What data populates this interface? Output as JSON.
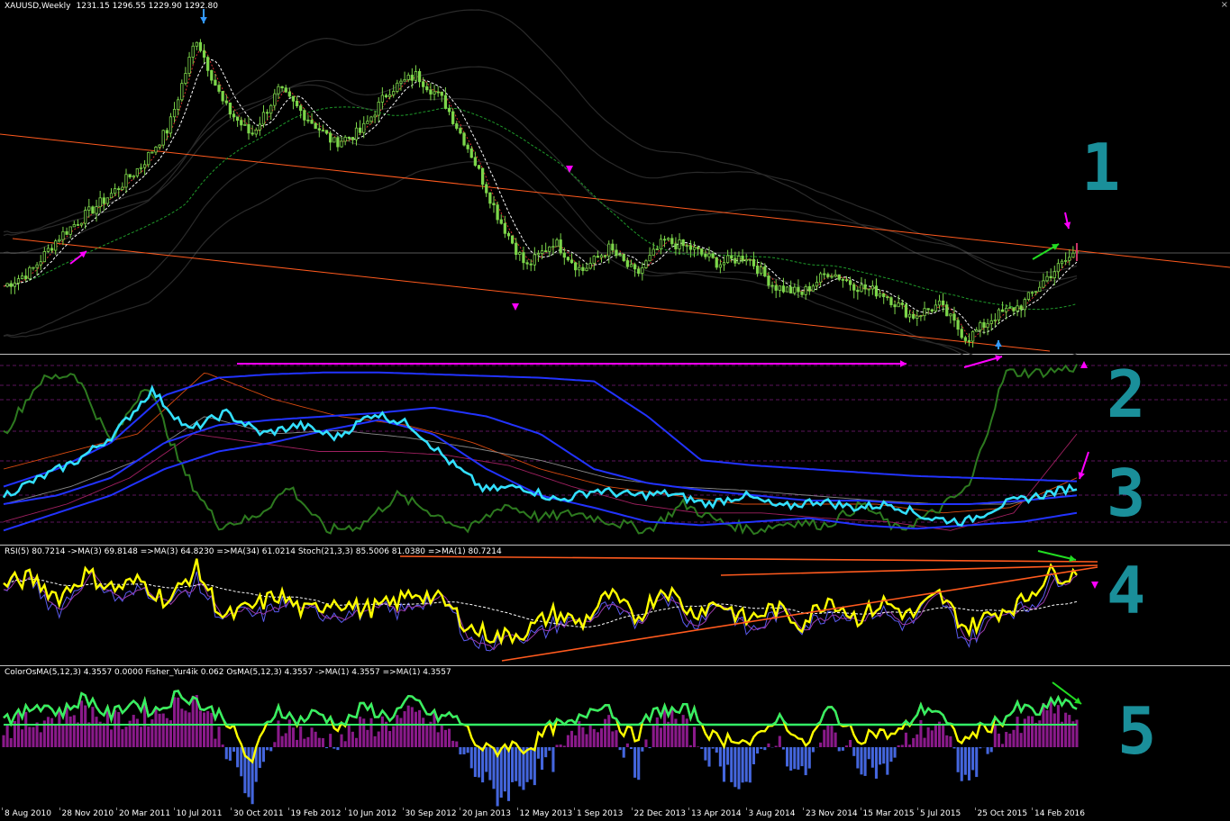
{
  "header": {
    "symbol": "XAUUSD,Weekly",
    "ohlc": "1231.15 1296.55 1229.90 1292.80",
    "close_glyph": "×"
  },
  "indicators": {
    "rsi_label": "RSI(5) 80.7214 ->MA(3) 69.8148 =>MA(3) 64.8230 =>MA(34) 61.0214 Stoch(21,3,3) 85.5006 81.0380 =>MA(1) 80.7214",
    "osma_label": "ColorOsMA(5,12,3) 4.3557 0.0000 Fisher_Yur4ik 0.062 OsMA(5,12,3) 4.3557 ->MA(1) 4.3557 =>MA(1) 4.3557"
  },
  "pane_numbers": [
    "1",
    "2",
    "3",
    "4",
    "5"
  ],
  "xaxis": {
    "ticks": [
      "8 Aug 2010",
      "28 Nov 2010",
      "20 Mar 2011",
      "10 Jul 2011",
      "30 Oct 2011",
      "19 Feb 2012",
      "10 Jun 2012",
      "30 Sep 2012",
      "20 Jan 2013",
      "12 May 2013",
      "1 Sep 2013",
      "22 Dec 2013",
      "13 Apr 2014",
      "3 Aug 2014",
      "23 Nov 2014",
      "15 Mar 2015",
      "5 Jul 2015",
      "25 Oct 2015",
      "14 Feb 2016"
    ]
  },
  "colors": {
    "bull_candle": "#7cd64a",
    "price_line": "#ffffff",
    "channel": "#ff5a1e",
    "arrow_magenta": "#ff00ff",
    "arrow_green": "#22dd22",
    "arrow_blue": "#3399ff",
    "pane_number": "#1a8f9a",
    "cyan_line": "#33e0ff",
    "blue_line": "#2233ff",
    "green_line": "#2d7a1f",
    "rsi_yellow": "#ffff00",
    "osma_purple": "#8a1a8a",
    "osma_blue": "#4466dd",
    "osma_green": "#33ee66"
  },
  "chart_data": {
    "type": "line",
    "title": "XAUUSD,Weekly",
    "x_labels": [
      "8 Aug 2010",
      "28 Nov 2010",
      "20 Mar 2011",
      "10 Jul 2011",
      "30 Oct 2011",
      "19 Feb 2012",
      "10 Jun 2012",
      "30 Sep 2012",
      "20 Jan 2013",
      "12 May 2013",
      "1 Sep 2013",
      "22 Dec 2013",
      "13 Apr 2014",
      "3 Aug 2014",
      "23 Nov 2014",
      "15 Mar 2015",
      "5 Jul 2015",
      "25 Oct 2015",
      "14 Feb 2016"
    ],
    "last_ohlc": {
      "open": 1231.15,
      "high": 1296.55,
      "low": 1229.9,
      "close": 1292.8
    },
    "price_close": [
      1200,
      1240,
      1330,
      1390,
      1450,
      1520,
      1620,
      1860,
      1680,
      1600,
      1720,
      1650,
      1580,
      1610,
      1720,
      1760,
      1690,
      1550,
      1380,
      1250,
      1320,
      1240,
      1300,
      1230,
      1320,
      1300,
      1260,
      1280,
      1200,
      1180,
      1240,
      1200,
      1180,
      1120,
      1150,
      1060,
      1120,
      1150,
      1230,
      1292.8
    ],
    "ylim": [
      1040,
      1930
    ],
    "rsi_yellow": [
      72,
      78,
      60,
      82,
      68,
      75,
      55,
      88,
      40,
      50,
      62,
      45,
      58,
      48,
      52,
      65,
      55,
      30,
      22,
      28,
      45,
      35,
      62,
      40,
      70,
      45,
      55,
      38,
      50,
      35,
      60,
      40,
      55,
      42,
      62,
      30,
      45,
      55,
      82,
      80.72
    ],
    "osma_hist": [
      3,
      4,
      5,
      6,
      4,
      5,
      6,
      8,
      1,
      -9,
      4,
      2,
      1,
      3,
      4,
      5,
      3,
      -3,
      -8,
      -5,
      -2,
      3,
      5,
      -4,
      6,
      2,
      -3,
      -6,
      2,
      -5,
      3,
      -2,
      -4,
      2,
      4,
      -6,
      2,
      3,
      6,
      4.3557
    ]
  }
}
